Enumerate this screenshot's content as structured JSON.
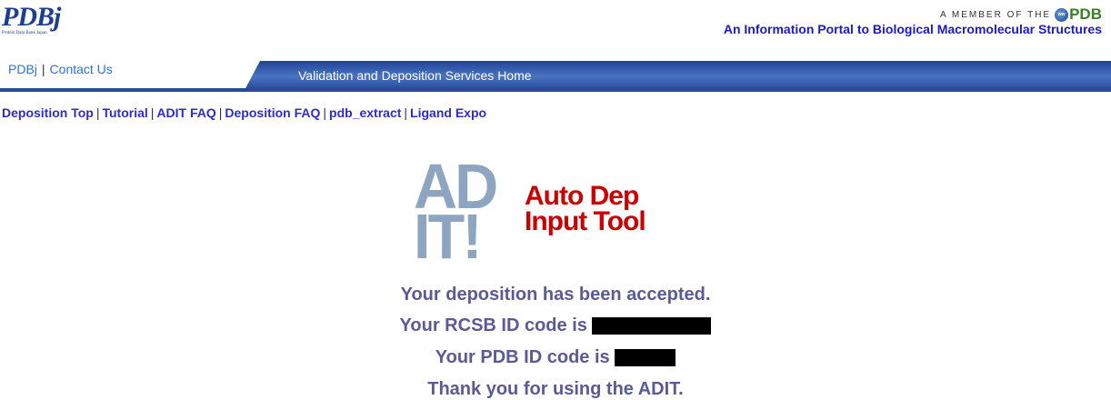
{
  "header": {
    "logo_text": "PDBj",
    "logo_subtext": "Protein Data Bank Japan",
    "member_prefix": "A MEMBER OF THE",
    "member_logo_small": "ww",
    "member_logo": "PDB",
    "tagline": "An Information Portal to Biological Macromolecular Structures"
  },
  "topnav": {
    "links": [
      {
        "label": "PDBj"
      },
      {
        "label": "Contact Us"
      }
    ],
    "separator": "|",
    "bar_title": "Validation and Deposition Services Home"
  },
  "sublinks": {
    "separator": "|",
    "items": [
      {
        "label": "Deposition Top"
      },
      {
        "label": "Tutorial"
      },
      {
        "label": "ADIT FAQ"
      },
      {
        "label": "Deposition FAQ"
      },
      {
        "label": "pdb_extract"
      },
      {
        "label": "Ligand Expo"
      }
    ]
  },
  "adit_logo": {
    "big_line1": "AD",
    "big_line2": "IT!",
    "red_line1": "Auto Dep",
    "red_line2": "Input Tool"
  },
  "messages": {
    "accepted": "Your deposition has been accepted.",
    "rcsb_label": "Your RCSB ID code is",
    "pdb_label": "Your PDB ID code is",
    "thanks": "Thank you for using the ADIT."
  },
  "colors": {
    "bar_dark": "#1e4596",
    "bar_light": "#5b84cc",
    "link_blue": "#2c2ccc",
    "message": "#5a5a96",
    "adit_grey": "#8ea5c1",
    "adit_red": "#cc0000"
  },
  "icons": {
    "wwpdb_logo": "wwpdb-globe-icon"
  }
}
